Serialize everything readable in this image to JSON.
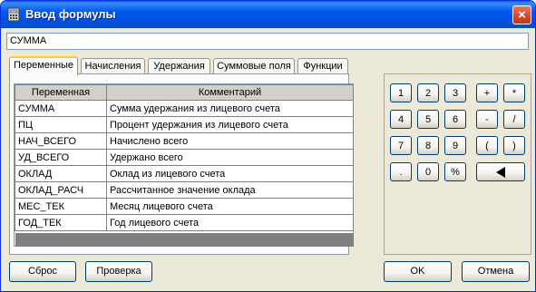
{
  "window": {
    "title": "Ввод формулы",
    "close_label": "×"
  },
  "formula": {
    "value": "СУММА"
  },
  "tabs": [
    {
      "label": "Переменные"
    },
    {
      "label": "Начисления"
    },
    {
      "label": "Удержания"
    },
    {
      "label": "Суммовые поля"
    },
    {
      "label": "Функции"
    }
  ],
  "grid": {
    "headers": [
      "Переменная",
      "Комментарий"
    ],
    "rows": [
      {
        "name": "СУММА",
        "comment": "Сумма удержания из лицевого счета"
      },
      {
        "name": "ПЦ",
        "comment": "Процент удержания из лицевого счета"
      },
      {
        "name": "НАЧ_ВСЕГО",
        "comment": "Начислено всего"
      },
      {
        "name": "УД_ВСЕГО",
        "comment": "Удержано всего"
      },
      {
        "name": "ОКЛАД",
        "comment": "Оклад из лицевого счета"
      },
      {
        "name": "ОКЛАД_РАСЧ",
        "comment": "Рассчитанное значение оклада"
      },
      {
        "name": "МЕС_ТЕК",
        "comment": "Месяц лицевого счета"
      },
      {
        "name": "ГОД_ТЕК",
        "comment": "Год лицевого счета"
      }
    ]
  },
  "keypad": {
    "keys": [
      "1",
      "2",
      "3",
      "+",
      "*",
      "4",
      "5",
      "6",
      "-",
      "/",
      "7",
      "8",
      "9",
      "(",
      ")",
      ".",
      "0",
      "%"
    ],
    "backspace_icon": "backspace-arrow-icon"
  },
  "footer": {
    "reset_label": "Сброс",
    "check_label": "Проверка",
    "ok_label": "OK",
    "cancel_label": "Отмена"
  }
}
